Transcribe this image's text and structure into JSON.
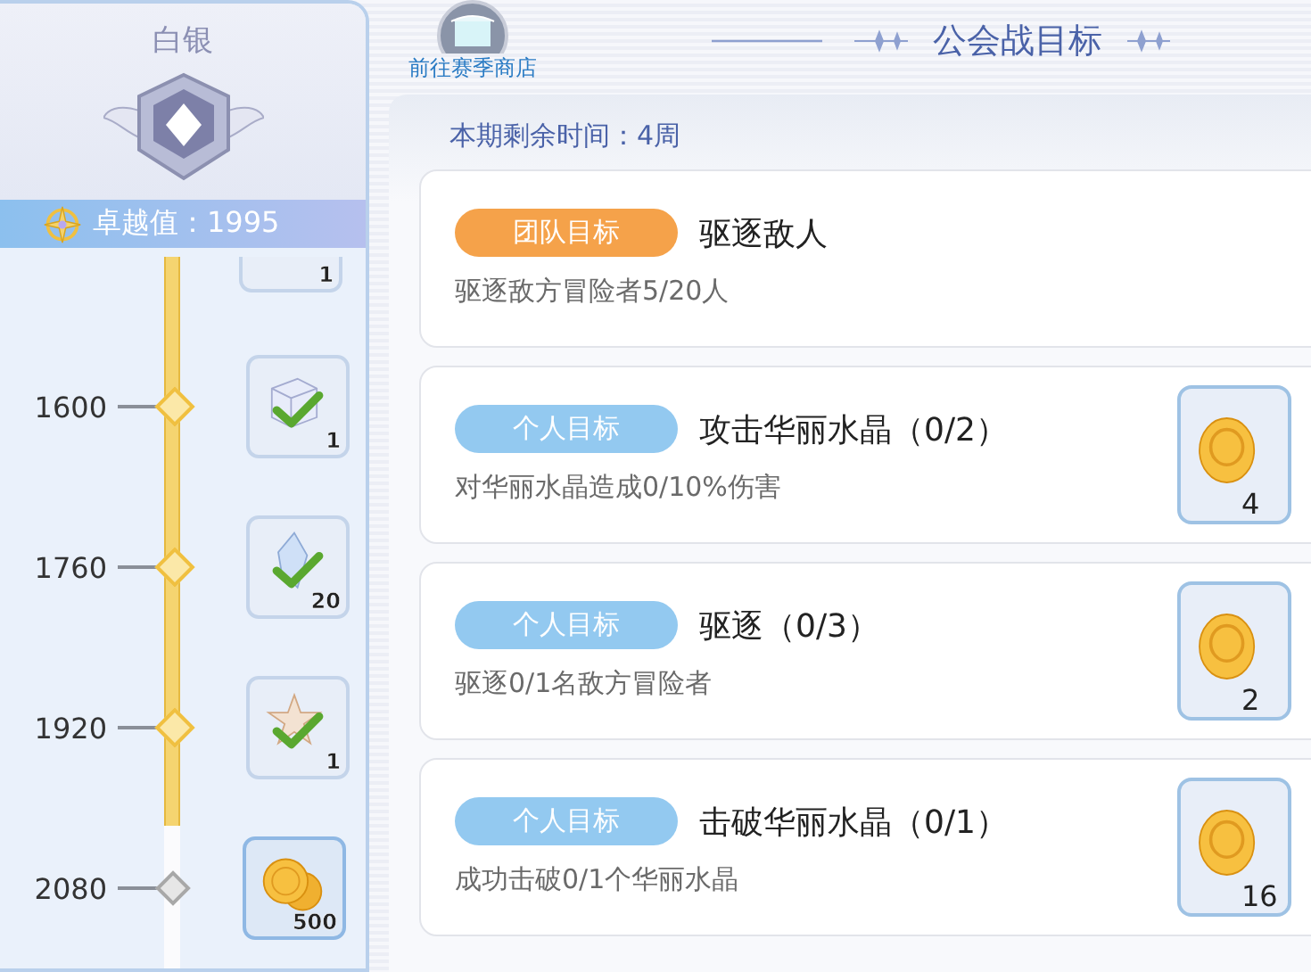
{
  "sidebar": {
    "rank": "白银",
    "score_label": "卓越值：1995",
    "track": {
      "level": 0.76
    },
    "milestones": [
      {
        "reward": {
          "count": "1"
        }
      },
      {
        "value": "1600",
        "reached": true,
        "reward": {
          "kind": "box",
          "count": "1",
          "claimed": true
        }
      },
      {
        "value": "1760",
        "reached": true,
        "reward": {
          "kind": "crystal",
          "count": "20",
          "claimed": true
        }
      },
      {
        "value": "1920",
        "reached": true,
        "reward": {
          "kind": "badge",
          "count": "1",
          "claimed": true
        }
      },
      {
        "value": "2080",
        "reached": false,
        "reward": {
          "kind": "coin",
          "count": "500",
          "claimed": false
        }
      }
    ]
  },
  "header": {
    "shop_link": "前往赛季商店",
    "title": "公会战目标"
  },
  "panel": {
    "time_left": "本期剩余时间：4周",
    "goals": [
      {
        "kind": "team",
        "tag": "团队目标",
        "title": "驱逐敌人",
        "description": "驱逐敌方冒险者5/20人"
      },
      {
        "kind": "personal",
        "tag": "个人目标",
        "title": "攻击华丽水晶（0/2）",
        "description": "对华丽水晶造成0/10%伤害",
        "reward": {
          "kind": "coin",
          "count": "4"
        }
      },
      {
        "kind": "personal",
        "tag": "个人目标",
        "title": "驱逐（0/3）",
        "description": "驱逐0/1名敌方冒险者",
        "reward": {
          "kind": "coin",
          "count": "2"
        }
      },
      {
        "kind": "personal",
        "tag": "个人目标",
        "title": "击破华丽水晶（0/1）",
        "description": "成功击破0/1个华丽水晶",
        "reward": {
          "kind": "coin",
          "count": "16"
        }
      }
    ]
  }
}
